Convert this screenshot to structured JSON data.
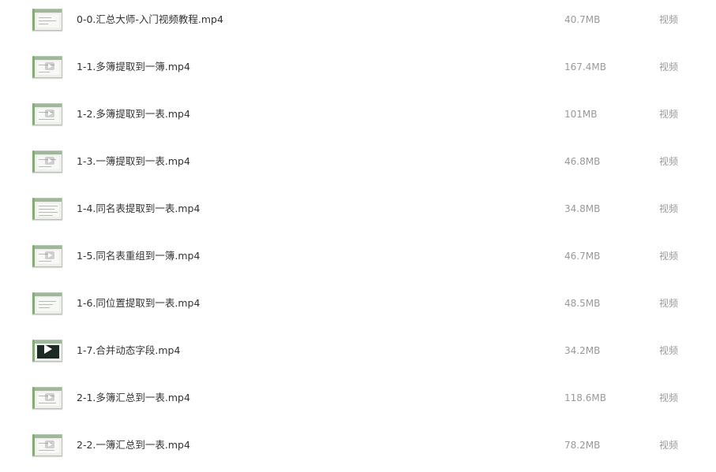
{
  "files": [
    {
      "name": "0-0.汇总大师-入门视频教程.mp4",
      "size": "40.7MB",
      "type": "视频",
      "thumbnail": "video-thumbnail-icon"
    },
    {
      "name": "1-1.多簿提取到一簿.mp4",
      "size": "167.4MB",
      "type": "视频",
      "thumbnail": "video-thumbnail-icon"
    },
    {
      "name": "1-2.多簿提取到一表.mp4",
      "size": "101MB",
      "type": "视频",
      "thumbnail": "video-thumbnail-icon"
    },
    {
      "name": "1-3.一簿提取到一表.mp4",
      "size": "46.8MB",
      "type": "视频",
      "thumbnail": "video-thumbnail-icon"
    },
    {
      "name": "1-4.同名表提取到一表.mp4",
      "size": "34.8MB",
      "type": "视频",
      "thumbnail": "video-thumbnail-icon"
    },
    {
      "name": "1-5.同名表重组到一簿.mp4",
      "size": "46.7MB",
      "type": "视频",
      "thumbnail": "video-thumbnail-icon"
    },
    {
      "name": "1-6.同位置提取到一表.mp4",
      "size": "48.5MB",
      "type": "视频",
      "thumbnail": "video-thumbnail-icon"
    },
    {
      "name": "1-7.合并动态字段.mp4",
      "size": "34.2MB",
      "type": "视频",
      "thumbnail": "video-thumbnail-dark-icon"
    },
    {
      "name": "2-1.多簿汇总到一表.mp4",
      "size": "118.6MB",
      "type": "视频",
      "thumbnail": "video-thumbnail-icon"
    },
    {
      "name": "2-2.一簿汇总到一表.mp4",
      "size": "78.2MB",
      "type": "视频",
      "thumbnail": "video-thumbnail-icon"
    }
  ]
}
